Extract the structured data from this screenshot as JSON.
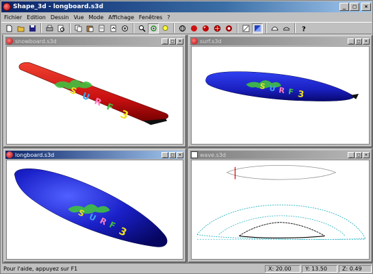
{
  "window": {
    "title": "Shape_3d - longboard.s3d"
  },
  "menu": [
    "Fichier",
    "Edition",
    "Dessin",
    "Vue",
    "Mode",
    "Affichage",
    "Fenêtres",
    "?"
  ],
  "toolbar_icons": [
    "new-file-icon",
    "open-folder-icon",
    "save-icon",
    "print-icon",
    "print-preview-icon",
    "copy-icon",
    "paste-icon",
    "document-icon",
    "export-icon",
    "settings-icon",
    "zoom-icon",
    "rotate-icon",
    "light-icon",
    "render-wire-icon",
    "render-red-icon",
    "render-solid-icon",
    "render-texture-icon",
    "render-axes-icon",
    "view-toggle-icon",
    "shade-icon",
    "measure-icon",
    "help-icon"
  ],
  "children": [
    {
      "title": "snowboard.s3d",
      "icon": "sphere-icon",
      "active": false
    },
    {
      "title": "surf.s3d",
      "icon": "sphere-icon",
      "active": false
    },
    {
      "title": "longboard.s3d",
      "icon": "sphere-icon",
      "active": true
    },
    {
      "title": "wave.s3d",
      "icon": "wave-doc-icon",
      "active": false
    }
  ],
  "board_graphic_text": "SURF 3",
  "status": {
    "message": "Pour l'aide, appuyez sur F1",
    "x": "X: 20.00",
    "y": "Y: 13.50",
    "z": "Z: 0.49"
  },
  "colors": {
    "snowboard": "#cc1010",
    "surfboard": "#1a20c8",
    "outline_red": "#cc0000",
    "outline_cyan": "#20b0c0"
  }
}
